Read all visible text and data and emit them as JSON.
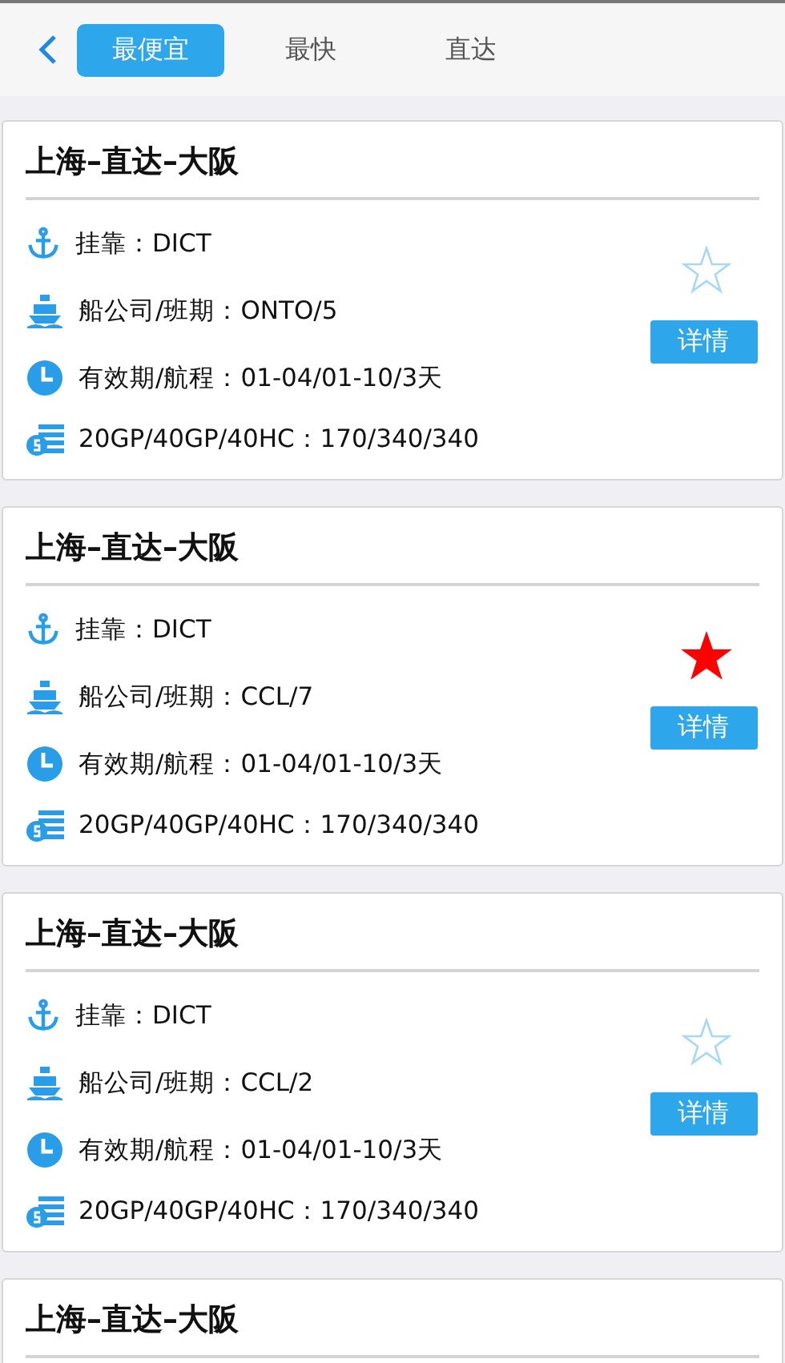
{
  "tabs": [
    {
      "label": "最便宜",
      "selected": true
    },
    {
      "label": "最快",
      "selected": false
    },
    {
      "label": "直达",
      "selected": false
    }
  ],
  "routes": [
    {
      "title": "上海–直达–大阪",
      "port": "挂靠：DICT",
      "carrier": "船公司/班期：ONTO/5",
      "validity": "有效期/航程：01-04/01-10/3天",
      "price": "20GP/40GP/40HC：170/340/340",
      "favorite": false,
      "details": "详情"
    },
    {
      "title": "上海–直达–大阪",
      "port": "挂靠：DICT",
      "carrier": "船公司/班期：CCL/7",
      "validity": "有效期/航程：01-04/01-10/3天",
      "price": "20GP/40GP/40HC：170/340/340",
      "favorite": true,
      "details": "详情"
    },
    {
      "title": "上海–直达–大阪",
      "port": "挂靠：DICT",
      "carrier": "船公司/班期：CCL/2",
      "validity": "有效期/航程：01-04/01-10/3天",
      "price": "20GP/40GP/40HC：170/340/340",
      "favorite": false,
      "details": "详情"
    },
    {
      "title": "上海–直达–大阪"
    }
  ]
}
